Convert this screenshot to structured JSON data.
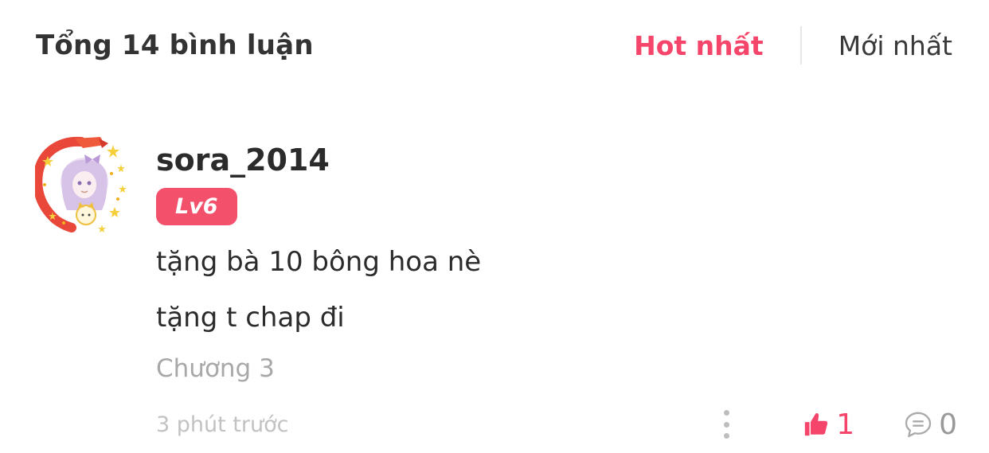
{
  "header": {
    "total_label": "Tổng 14 bình luận",
    "tabs": [
      {
        "label": "Hot nhất",
        "active": true
      },
      {
        "label": "Mới nhất",
        "active": false
      }
    ]
  },
  "comment": {
    "username": "sora_2014",
    "level": "Lv6",
    "lines": [
      "tặng bà 10 bông hoa nè",
      "tặng t chap đi"
    ],
    "chapter": "Chương 3",
    "time": "3 phút trước",
    "likes": "1",
    "replies": "0",
    "icons": {
      "more": "more-vertical-icon",
      "like": "thumbs-up-icon",
      "reply": "chat-bubble-icon"
    }
  },
  "colors": {
    "accent": "#f5456b",
    "badge": "#f3506b",
    "muted": "#a8a8a8"
  }
}
